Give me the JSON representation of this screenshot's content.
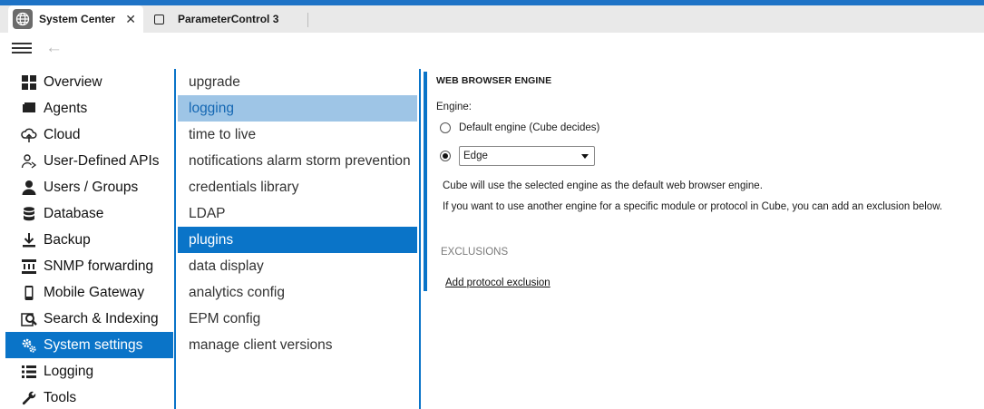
{
  "tabs": [
    {
      "label": "System Center",
      "close": "✕",
      "active": true
    },
    {
      "label": "ParameterControl 3",
      "active": false
    }
  ],
  "nav": [
    {
      "label": "Overview",
      "icon": "grid-icon"
    },
    {
      "label": "Agents",
      "icon": "agents-icon"
    },
    {
      "label": "Cloud",
      "icon": "cloud-upload-icon"
    },
    {
      "label": "User-Defined APIs",
      "icon": "api-user-icon"
    },
    {
      "label": "Users / Groups",
      "icon": "user-icon"
    },
    {
      "label": "Database",
      "icon": "database-icon"
    },
    {
      "label": "Backup",
      "icon": "download-icon"
    },
    {
      "label": "SNMP forwarding",
      "icon": "snmp-icon"
    },
    {
      "label": "Mobile Gateway",
      "icon": "phone-icon"
    },
    {
      "label": "Search & Indexing",
      "icon": "search-icon"
    },
    {
      "label": "System settings",
      "icon": "gears-icon",
      "selected": true
    },
    {
      "label": "Logging",
      "icon": "list-icon"
    },
    {
      "label": "Tools",
      "icon": "wrench-icon"
    }
  ],
  "sub": [
    {
      "label": "upgrade"
    },
    {
      "label": "logging",
      "hl": "light"
    },
    {
      "label": "time to live"
    },
    {
      "label": "notifications alarm storm prevention"
    },
    {
      "label": "credentials library"
    },
    {
      "label": "LDAP"
    },
    {
      "label": "plugins",
      "hl": "dark"
    },
    {
      "label": "data display"
    },
    {
      "label": "analytics config"
    },
    {
      "label": "EPM config"
    },
    {
      "label": "manage client versions"
    }
  ],
  "content": {
    "title": "WEB BROWSER ENGINE",
    "engine_label": "Engine:",
    "option_default": "Default engine (Cube decides)",
    "selected_engine": "Edge",
    "info1": "Cube will use the selected engine as the default web browser engine.",
    "info2": "If you want to use another engine for a specific module or protocol in Cube, you can add an exclusion below.",
    "exclusions_heading": "EXCLUSIONS",
    "add_link": "Add protocol exclusion"
  },
  "colors": {
    "accent": "#0a74c8",
    "highlight_light": "#9ec5e6",
    "topbar": "#1e73c6"
  }
}
